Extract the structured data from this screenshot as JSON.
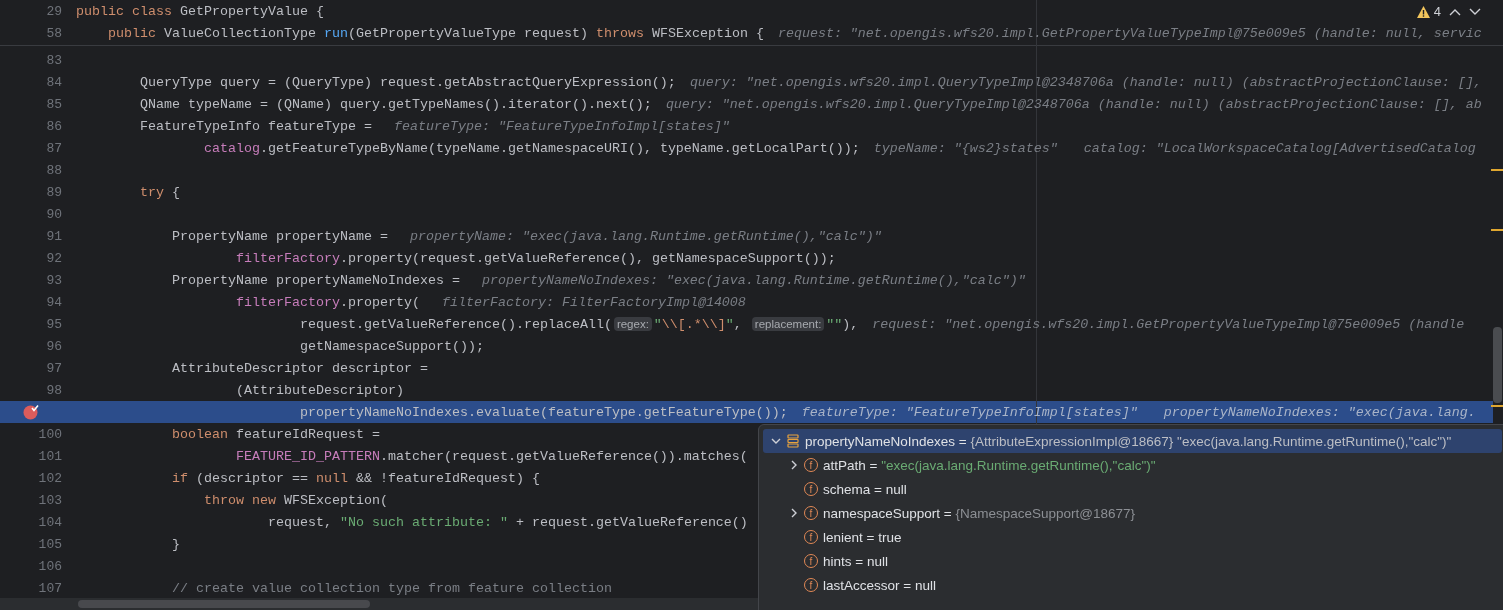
{
  "sticky_header": [
    {
      "number": "29",
      "tokens": [
        {
          "kind": "keyword",
          "text": "public class "
        },
        {
          "kind": "plain",
          "text": "GetPropertyValue {"
        }
      ]
    },
    {
      "number": "58",
      "tokens": [
        {
          "kind": "keyword",
          "text": "    public "
        },
        {
          "kind": "plain",
          "text": "ValueCollectionType "
        },
        {
          "kind": "method",
          "text": "run"
        },
        {
          "kind": "plain",
          "text": "(GetPropertyValueType request) "
        },
        {
          "kind": "keyword",
          "text": "throws "
        },
        {
          "kind": "plain",
          "text": "WFSException {"
        }
      ],
      "hints": [
        "request: \"net.opengis.wfs20.impl.GetPropertyValueTypeImpl@75e009e5 (handle: null, servic"
      ]
    }
  ],
  "problems": {
    "warnings": "4"
  },
  "lines": [
    {
      "number": "83",
      "selected": false,
      "breakpoint": false
    },
    {
      "number": "84",
      "selected": false,
      "breakpoint": false,
      "tokens": [
        {
          "kind": "plain",
          "text": "        QueryType query = (QueryType) request.getAbstractQueryExpression();"
        }
      ],
      "hints": [
        "query: \"net.opengis.wfs20.impl.QueryTypeImpl@2348706a (handle: null) (abstractProjectionClause: [],"
      ]
    },
    {
      "number": "85",
      "selected": false,
      "breakpoint": false,
      "tokens": [
        {
          "kind": "plain",
          "text": "        QName typeName = (QName) query.getTypeNames().iterator().next();"
        }
      ],
      "hints": [
        "query: \"net.opengis.wfs20.impl.QueryTypeImpl@2348706a (handle: null) (abstractProjectionClause: [], ab"
      ]
    },
    {
      "number": "86",
      "selected": false,
      "breakpoint": false,
      "tokens": [
        {
          "kind": "plain",
          "text": "        FeatureTypeInfo featureType = "
        }
      ],
      "hints": [
        "featureType: \"FeatureTypeInfoImpl[states]\""
      ]
    },
    {
      "number": "87",
      "selected": false,
      "breakpoint": false,
      "tokens": [
        {
          "kind": "field",
          "text": "                catalog"
        },
        {
          "kind": "plain",
          "text": ".getFeatureTypeByName(typeName.getNamespaceURI(), typeName.getLocalPart());"
        }
      ],
      "hints": [
        "typeName: \"{ws2}states\"",
        "catalog: \"LocalWorkspaceCatalog[AdvertisedCatalog"
      ]
    },
    {
      "number": "88",
      "selected": false,
      "breakpoint": false
    },
    {
      "number": "89",
      "selected": false,
      "breakpoint": false,
      "tokens": [
        {
          "kind": "keyword",
          "text": "        try "
        },
        {
          "kind": "plain",
          "text": "{"
        }
      ]
    },
    {
      "number": "90",
      "selected": false,
      "breakpoint": false
    },
    {
      "number": "91",
      "selected": false,
      "breakpoint": false,
      "tokens": [
        {
          "kind": "plain",
          "text": "            PropertyName propertyName = "
        }
      ],
      "hints": [
        "propertyName: \"exec(java.lang.Runtime.getRuntime(),\"calc\")\""
      ]
    },
    {
      "number": "92",
      "selected": false,
      "breakpoint": false,
      "tokens": [
        {
          "kind": "field",
          "text": "                    filterFactory"
        },
        {
          "kind": "plain",
          "text": ".property(request.getValueReference(), getNamespaceSupport());"
        }
      ]
    },
    {
      "number": "93",
      "selected": false,
      "breakpoint": false,
      "tokens": [
        {
          "kind": "plain",
          "text": "            PropertyName propertyNameNoIndexes = "
        }
      ],
      "hints": [
        "propertyNameNoIndexes: \"exec(java.lang.Runtime.getRuntime(),\"calc\")\""
      ]
    },
    {
      "number": "94",
      "selected": false,
      "breakpoint": false,
      "tokens": [
        {
          "kind": "field",
          "text": "                    filterFactory"
        },
        {
          "kind": "plain",
          "text": ".property( "
        }
      ],
      "hints": [
        "filterFactory: FilterFactoryImpl@14008"
      ]
    },
    {
      "number": "95",
      "selected": false,
      "breakpoint": false,
      "tokens": [
        {
          "kind": "plain",
          "text": "                            request.getValueReference().replaceAll("
        },
        {
          "kind": "param_hint",
          "text": "regex:"
        },
        {
          "kind": "string",
          "text": "\""
        },
        {
          "kind": "escape",
          "text": "\\\\[.*\\\\]"
        },
        {
          "kind": "string",
          "text": "\""
        },
        {
          "kind": "plain",
          "text": ", "
        },
        {
          "kind": "param_hint",
          "text": "replacement:"
        },
        {
          "kind": "string",
          "text": "\"\""
        },
        {
          "kind": "plain",
          "text": "),"
        }
      ],
      "hints": [
        "request: \"net.opengis.wfs20.impl.GetPropertyValueTypeImpl@75e009e5 (handle"
      ]
    },
    {
      "number": "96",
      "selected": false,
      "breakpoint": false,
      "tokens": [
        {
          "kind": "plain",
          "text": "                            getNamespaceSupport());"
        }
      ]
    },
    {
      "number": "97",
      "selected": false,
      "breakpoint": false,
      "tokens": [
        {
          "kind": "plain",
          "text": "            AttributeDescriptor descriptor ="
        }
      ]
    },
    {
      "number": "98",
      "selected": false,
      "breakpoint": false,
      "tokens": [
        {
          "kind": "plain",
          "text": "                    (AttributeDescriptor)"
        }
      ]
    },
    {
      "selected": true,
      "breakpoint": true,
      "tokens": [
        {
          "kind": "plain",
          "text": "                            propertyNameNoIndexes.evaluate(featureType.getFeatureType());"
        }
      ],
      "hints": [
        "featureType: \"FeatureTypeInfoImpl[states]\"",
        "propertyNameNoIndexes: \"exec(java.lang."
      ]
    },
    {
      "number": "100",
      "selected": false,
      "breakpoint": false,
      "tokens": [
        {
          "kind": "keyword",
          "text": "            boolean "
        },
        {
          "kind": "plain",
          "text": "featureIdRequest ="
        }
      ]
    },
    {
      "number": "101",
      "selected": false,
      "breakpoint": false,
      "tokens": [
        {
          "kind": "field",
          "text": "                    FEATURE_ID_PATTERN"
        },
        {
          "kind": "plain",
          "text": ".matcher(request.getValueReference()).matches("
        }
      ]
    },
    {
      "number": "102",
      "selected": false,
      "breakpoint": false,
      "tokens": [
        {
          "kind": "keyword",
          "text": "            if "
        },
        {
          "kind": "plain",
          "text": "(descriptor == "
        },
        {
          "kind": "keyword",
          "text": "null "
        },
        {
          "kind": "plain",
          "text": "&& !featureIdRequest) {"
        }
      ]
    },
    {
      "number": "103",
      "selected": false,
      "breakpoint": false,
      "tokens": [
        {
          "kind": "keyword",
          "text": "                throw new "
        },
        {
          "kind": "plain",
          "text": "WFSException("
        }
      ]
    },
    {
      "number": "104",
      "selected": false,
      "breakpoint": false,
      "tokens": [
        {
          "kind": "plain",
          "text": "                        request, "
        },
        {
          "kind": "string",
          "text": "\"No such attribute: \""
        },
        {
          "kind": "plain",
          "text": " + request.getValueReference()"
        }
      ]
    },
    {
      "number": "105",
      "selected": false,
      "breakpoint": false,
      "tokens": [
        {
          "kind": "plain",
          "text": "            }"
        }
      ]
    },
    {
      "number": "106",
      "selected": false,
      "breakpoint": false
    },
    {
      "number": "107",
      "selected": false,
      "breakpoint": false,
      "tokens": [
        {
          "kind": "comment",
          "text": "            // create value collection type from feature collection"
        }
      ]
    }
  ],
  "debug_popup": {
    "root": {
      "name": "propertyNameNoIndexes",
      "equals": "=",
      "type": "{AttributeExpressionImpl@18667}",
      "value": "\"exec(java.lang.Runtime.getRuntime(),\"calc\")\"",
      "expanded": true,
      "selected": true
    },
    "children": [
      {
        "kind": "node",
        "expanded": false,
        "selected": false,
        "badge": "f",
        "name": "attPath",
        "equals": "=",
        "value": "\"exec(java.lang.Runtime.getRuntime(),\"calc\")\"",
        "color": "#6aab73"
      },
      {
        "kind": "leaf",
        "selected": false,
        "badge": "f",
        "name": "schema",
        "equals": "=",
        "value": "null",
        "color": "#dfe1e5"
      },
      {
        "kind": "node",
        "expanded": false,
        "selected": false,
        "badge": "f",
        "name": "namespaceSupport",
        "equals": "=",
        "value": "{NamespaceSupport@18677}",
        "color": "#8c8f94"
      },
      {
        "kind": "leaf",
        "selected": false,
        "badge": "f",
        "name": "lenient",
        "equals": "=",
        "value": "true",
        "color": "#dfe1e5"
      },
      {
        "kind": "leaf",
        "selected": false,
        "badge": "f",
        "name": "hints",
        "equals": "=",
        "value": "null",
        "color": "#dfe1e5"
      },
      {
        "kind": "leaf",
        "selected": false,
        "badge": "f",
        "name": "lastAccessor",
        "equals": "=",
        "value": "null",
        "color": "#dfe1e5"
      }
    ]
  }
}
